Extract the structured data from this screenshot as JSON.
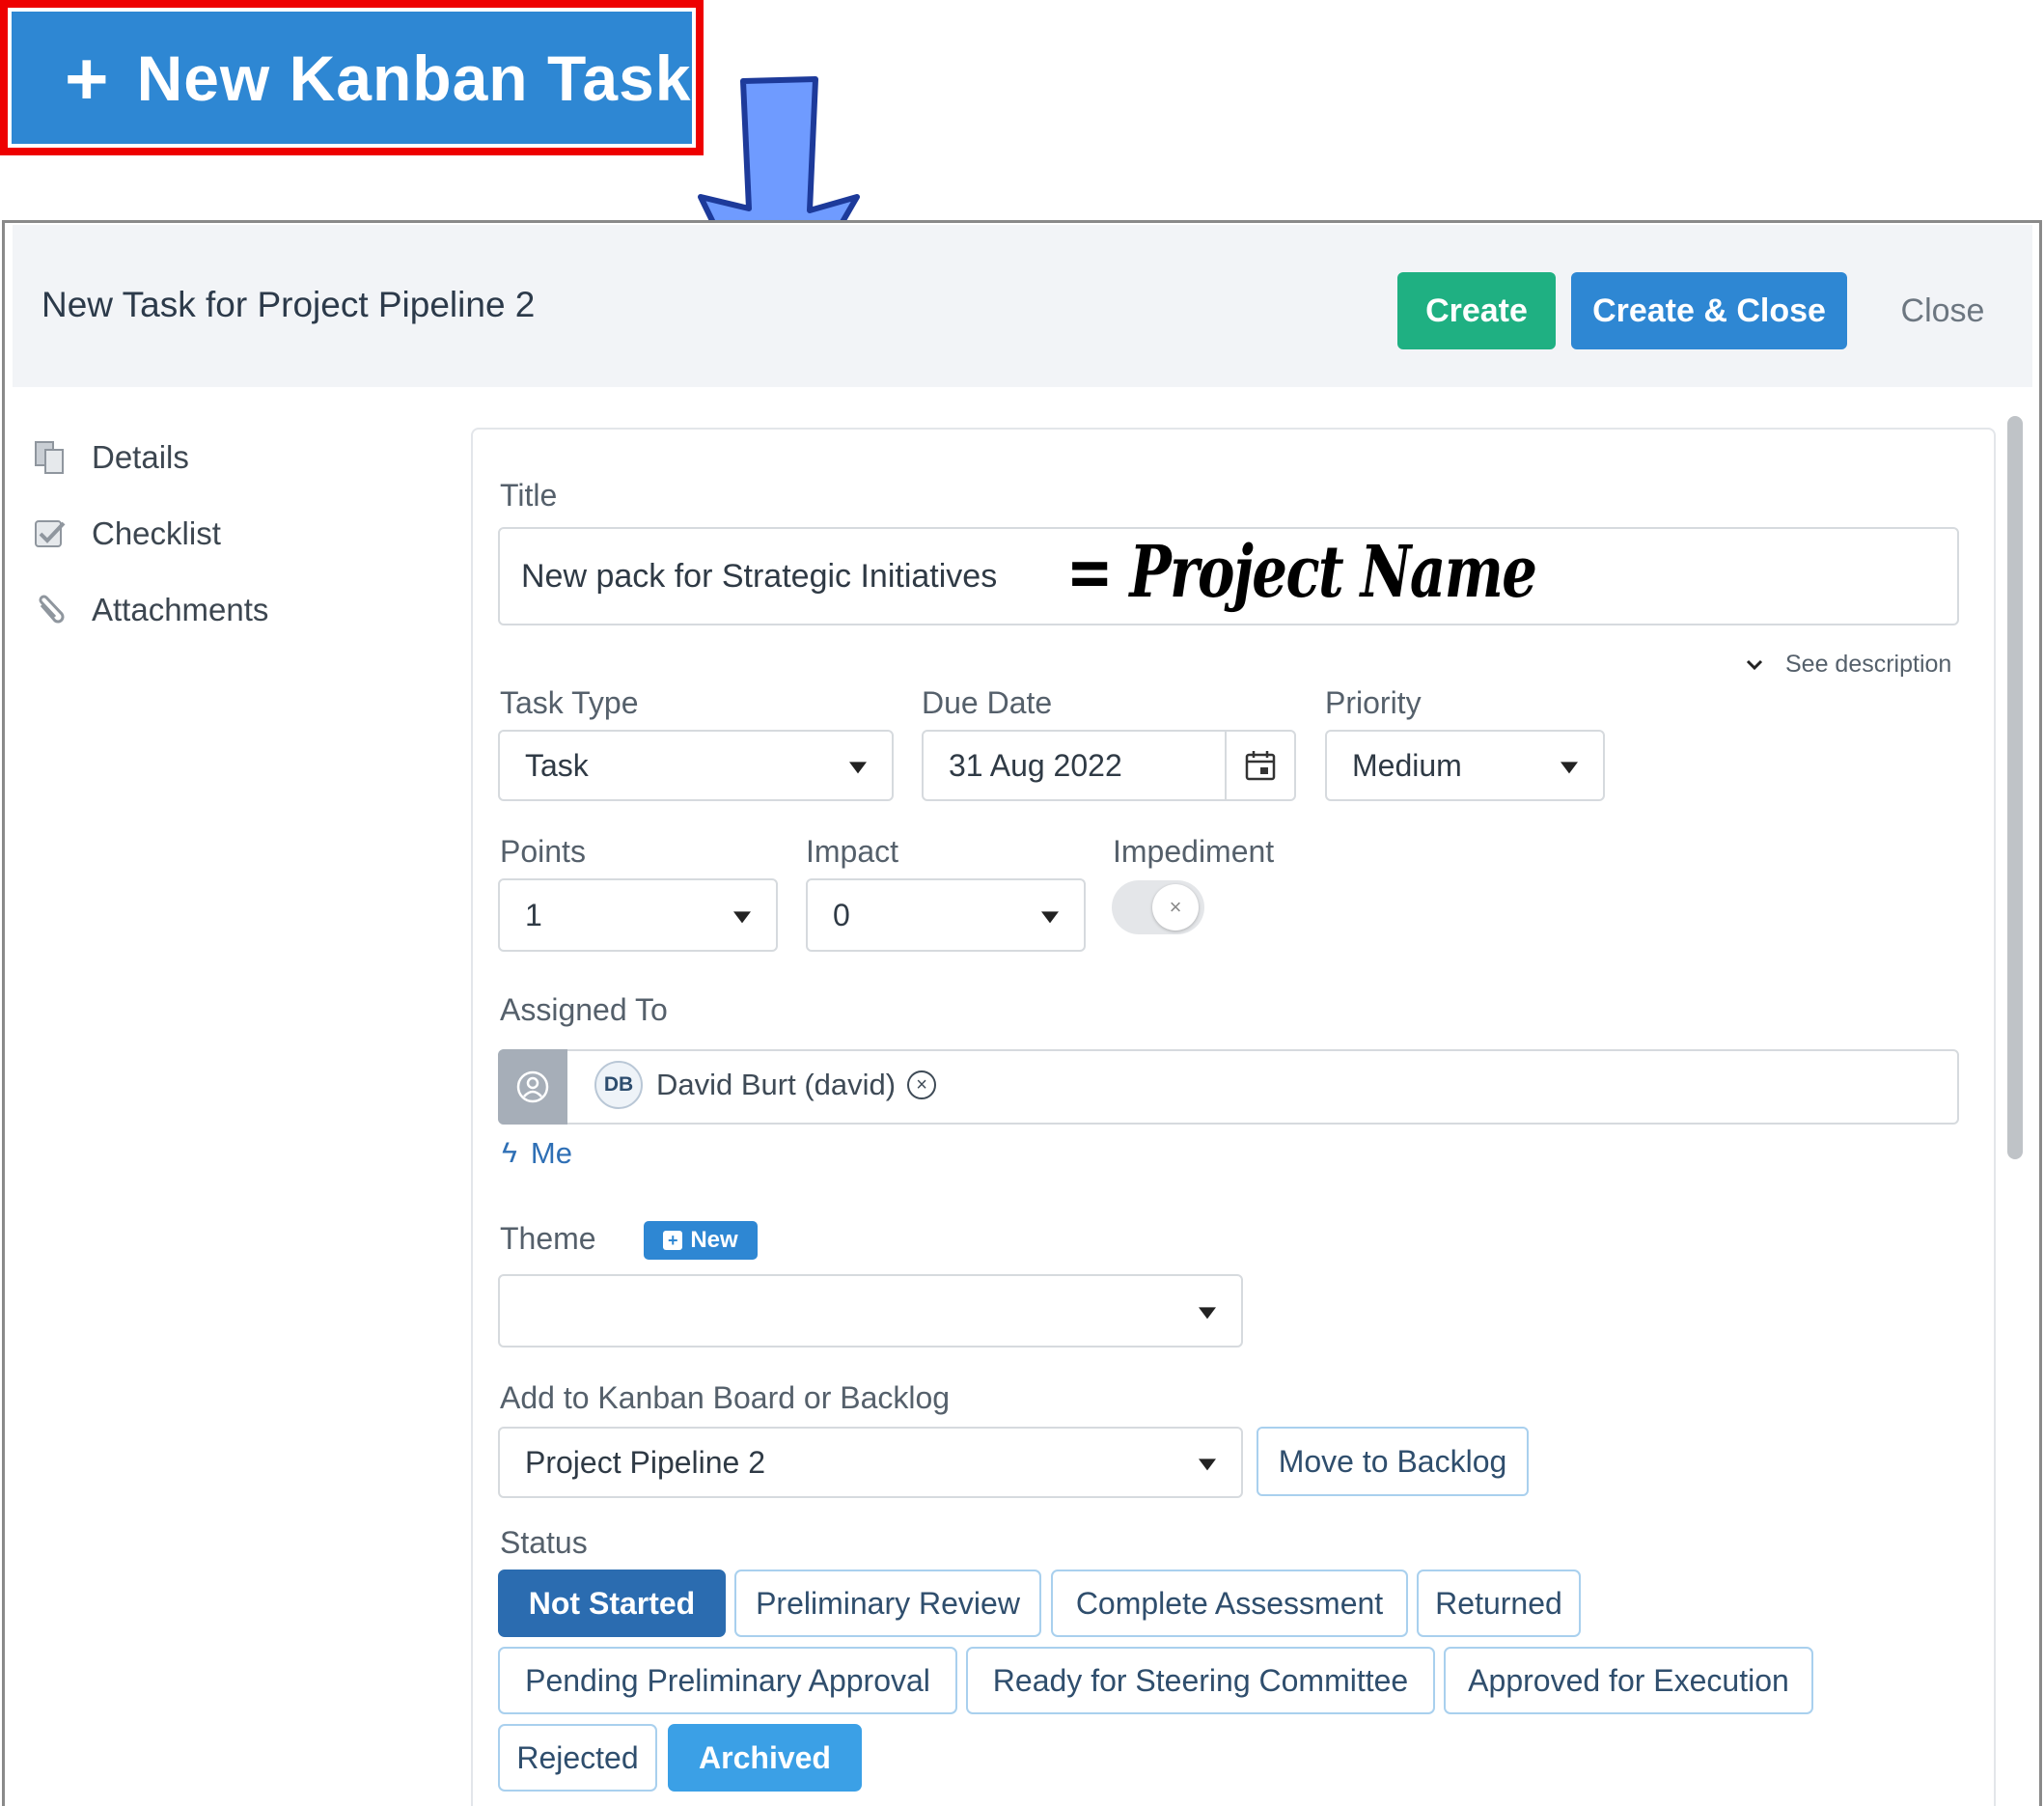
{
  "launcher": {
    "label": "New Kanban Task",
    "icon": "plus-icon"
  },
  "annotation": {
    "handwritten_note": "= Project Name",
    "highlight_color": "#ee0000",
    "arrow_color": "#6f9bff"
  },
  "dialog": {
    "title": "New Task for Project Pipeline 2",
    "actions": {
      "create": "Create",
      "create_close": "Create & Close",
      "close": "Close"
    },
    "colors": {
      "create": "#1fb082",
      "create_close": "#2e87d3"
    }
  },
  "sidebar": {
    "items": [
      {
        "label": "Details",
        "icon": "document-icon"
      },
      {
        "label": "Checklist",
        "icon": "checkbox-icon"
      },
      {
        "label": "Attachments",
        "icon": "paperclip-icon"
      }
    ]
  },
  "form": {
    "title": {
      "label": "Title",
      "value": "New pack for Strategic Initiatives"
    },
    "see_description": "See description",
    "task_type": {
      "label": "Task Type",
      "value": "Task"
    },
    "due_date": {
      "label": "Due Date",
      "value": "31 Aug 2022"
    },
    "priority": {
      "label": "Priority",
      "value": "Medium"
    },
    "points": {
      "label": "Points",
      "value": "1"
    },
    "impact": {
      "label": "Impact",
      "value": "0"
    },
    "impediment": {
      "label": "Impediment",
      "on": false
    },
    "assigned_to": {
      "label": "Assigned To",
      "initials": "DB",
      "name": "David Burt (david)",
      "me_link": "Me"
    },
    "theme": {
      "label": "Theme",
      "new_badge": "New",
      "value": ""
    },
    "board": {
      "label": "Add to Kanban Board or Backlog",
      "value": "Project Pipeline 2",
      "move_button": "Move to Backlog"
    },
    "status": {
      "label": "Status",
      "options": [
        "Not Started",
        "Preliminary Review",
        "Complete Assessment",
        "Returned",
        "Pending Preliminary Approval",
        "Ready for Steering Committee",
        "Approved for Execution",
        "Rejected",
        "Archived"
      ],
      "selected": [
        "Not Started",
        "Archived"
      ]
    }
  }
}
